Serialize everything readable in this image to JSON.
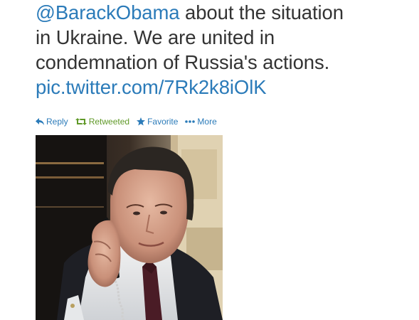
{
  "tweet": {
    "partial_line": "...",
    "mention": "@BarackObama",
    "text_after_mention": " about the situation",
    "line2": "in Ukraine. We are united in",
    "line3": "condemnation of Russia's actions.",
    "pic_link": "pic.twitter.com/7Rk2k8iOlK"
  },
  "actions": {
    "reply": "Reply",
    "retweeted": "Retweeted",
    "favorite": "Favorite",
    "more": "More"
  },
  "colors": {
    "link": "#2b7bb9",
    "retweeted": "#609928",
    "text": "#333333"
  },
  "icons": {
    "reply": "reply-arrow-icon",
    "retweet": "retweet-icon",
    "favorite": "star-icon",
    "more": "ellipsis-icon"
  }
}
